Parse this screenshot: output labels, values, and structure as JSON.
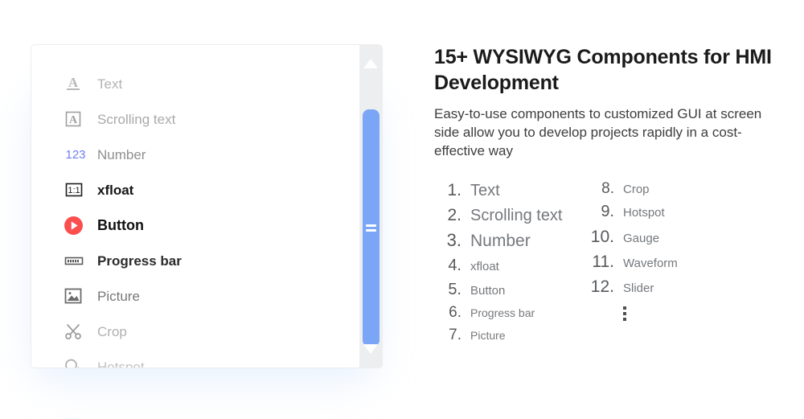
{
  "palette": {
    "accent_blue": "#7aa6f5",
    "scroll_track": "#eceef0",
    "number_icon_blue": "#6f7ef0",
    "button_red": "#fb4e4e",
    "card_border": "#ededed",
    "shadow_blue": "#cfe3fb"
  },
  "card": {
    "components": [
      {
        "icon": "text-underline-icon",
        "label": "Text",
        "color": "#b3b3b3",
        "size": 17,
        "weight": "normal",
        "icon_color": "#b9b9b9"
      },
      {
        "icon": "boxed-letter-a-icon",
        "label": "Scrolling text",
        "color": "#a9a9a9",
        "size": 17,
        "weight": "normal",
        "icon_color": "#9e9e9e"
      },
      {
        "icon": "digits-123-icon",
        "label": "Number",
        "color": "#8f8f8f",
        "size": 17,
        "weight": "normal",
        "icon_color": "#6f7ef0"
      },
      {
        "icon": "ratio-1-1-icon",
        "label": "xfloat",
        "color": "#151515",
        "size": 17,
        "weight": "bold",
        "icon_color": "#1d1d1d"
      },
      {
        "icon": "play-button-icon",
        "label": "Button",
        "color": "#111111",
        "size": 18,
        "weight": "bold",
        "icon_color": "#fb4e4e"
      },
      {
        "icon": "progress-bar-icon",
        "label": "Progress bar",
        "color": "#2b2b2b",
        "size": 17,
        "weight": "bold",
        "icon_color": "#5a5a5a"
      },
      {
        "icon": "picture-icon",
        "label": "Picture",
        "color": "#777777",
        "size": 17,
        "weight": "normal",
        "icon_color": "#6b6b6b"
      },
      {
        "icon": "scissors-crop-icon",
        "label": "Crop",
        "color": "#b0b0b0",
        "size": 17,
        "weight": "normal",
        "icon_color": "#9a9a9a"
      },
      {
        "icon": "hotspot-icon",
        "label": "Hotspot",
        "color": "#c2c2c2",
        "size": 17,
        "weight": "normal",
        "icon_color": "#adadad"
      }
    ],
    "scrollbar": {
      "up_arrow": "triangle-up-icon",
      "down_arrow": "triangle-down-icon",
      "thumb_grip": "grip-lines-icon"
    }
  },
  "right": {
    "headline": "15+ WYSIWYG Components for HMI Development",
    "subcopy": "Easy-to-use components to customized GUI at screen side allow you to develop projects rapidly in a cost-effective way",
    "column_left": [
      {
        "num": "1.",
        "label": "Text",
        "num_size": 21,
        "label_size": 20
      },
      {
        "num": "2.",
        "label": "Scrolling text",
        "num_size": 21,
        "label_size": 20
      },
      {
        "num": "3.",
        "label": "Number",
        "num_size": 22,
        "label_size": 21
      },
      {
        "num": "4.",
        "label": "xfloat",
        "num_size": 20,
        "label_size": 15
      },
      {
        "num": "5.",
        "label": "Button",
        "num_size": 20,
        "label_size": 15
      },
      {
        "num": "6.",
        "label": "Progress bar",
        "num_size": 19,
        "label_size": 14
      },
      {
        "num": "7.",
        "label": "Picture",
        "num_size": 19,
        "label_size": 14
      }
    ],
    "column_right": [
      {
        "num": "8.",
        "label": "Crop",
        "num_size": 19,
        "label_size": 15
      },
      {
        "num": "9.",
        "label": "Hotspot",
        "num_size": 20,
        "label_size": 15
      },
      {
        "num": "10.",
        "label": "Gauge",
        "num_size": 21,
        "label_size": 15
      },
      {
        "num": "11.",
        "label": "Waveform",
        "num_size": 21,
        "label_size": 15
      },
      {
        "num": "12.",
        "label": "Slider",
        "num_size": 21,
        "label_size": 15
      }
    ],
    "ellipsis": "vertical-ellipsis-icon"
  }
}
